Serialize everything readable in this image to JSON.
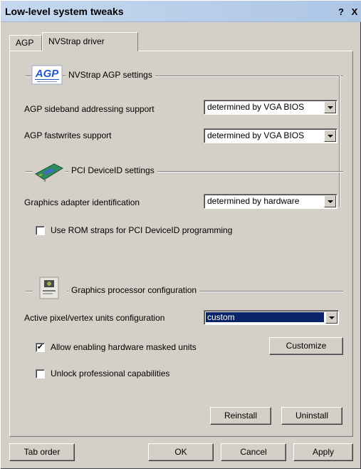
{
  "window": {
    "title": "Low-level system tweaks",
    "help_label": "?",
    "close_label": "X"
  },
  "tabs": [
    {
      "label": "AGP",
      "active": false
    },
    {
      "label": "NVStrap driver",
      "active": true
    }
  ],
  "agp_group": {
    "title": "NVStrap AGP settings",
    "logo_text": "AGP",
    "sideband": {
      "label": "AGP sideband addressing support",
      "value": "determined by VGA BIOS"
    },
    "fastwrites": {
      "label": "AGP fastwrites support",
      "value": "determined by VGA BIOS"
    }
  },
  "pci_group": {
    "title": "PCI DeviceID settings",
    "adapter": {
      "label": "Graphics adapter identification",
      "value": "determined by hardware"
    },
    "rom_straps": {
      "label": "Use ROM straps for PCI DeviceID programming",
      "checked": false
    }
  },
  "gpu_group": {
    "title": "Graphics processor configuration",
    "units": {
      "label": "Active pixel/vertex units configuration",
      "value": "custom"
    },
    "masked_units": {
      "label": "Allow enabling hardware masked units",
      "checked": true,
      "check_glyph": "✔"
    },
    "customize_label": "Customize",
    "professional": {
      "label": "Unlock professional capabilities",
      "checked": false
    }
  },
  "panel_buttons": {
    "reinstall": "Reinstall",
    "uninstall": "Uninstall"
  },
  "footer": {
    "tab_order": "Tab order",
    "ok": "OK",
    "cancel": "Cancel",
    "apply": "Apply"
  },
  "colors": {
    "selection": "#0a246a",
    "agp_logo_blue": "#1f57c9",
    "board_green": "#2f8a5c"
  }
}
